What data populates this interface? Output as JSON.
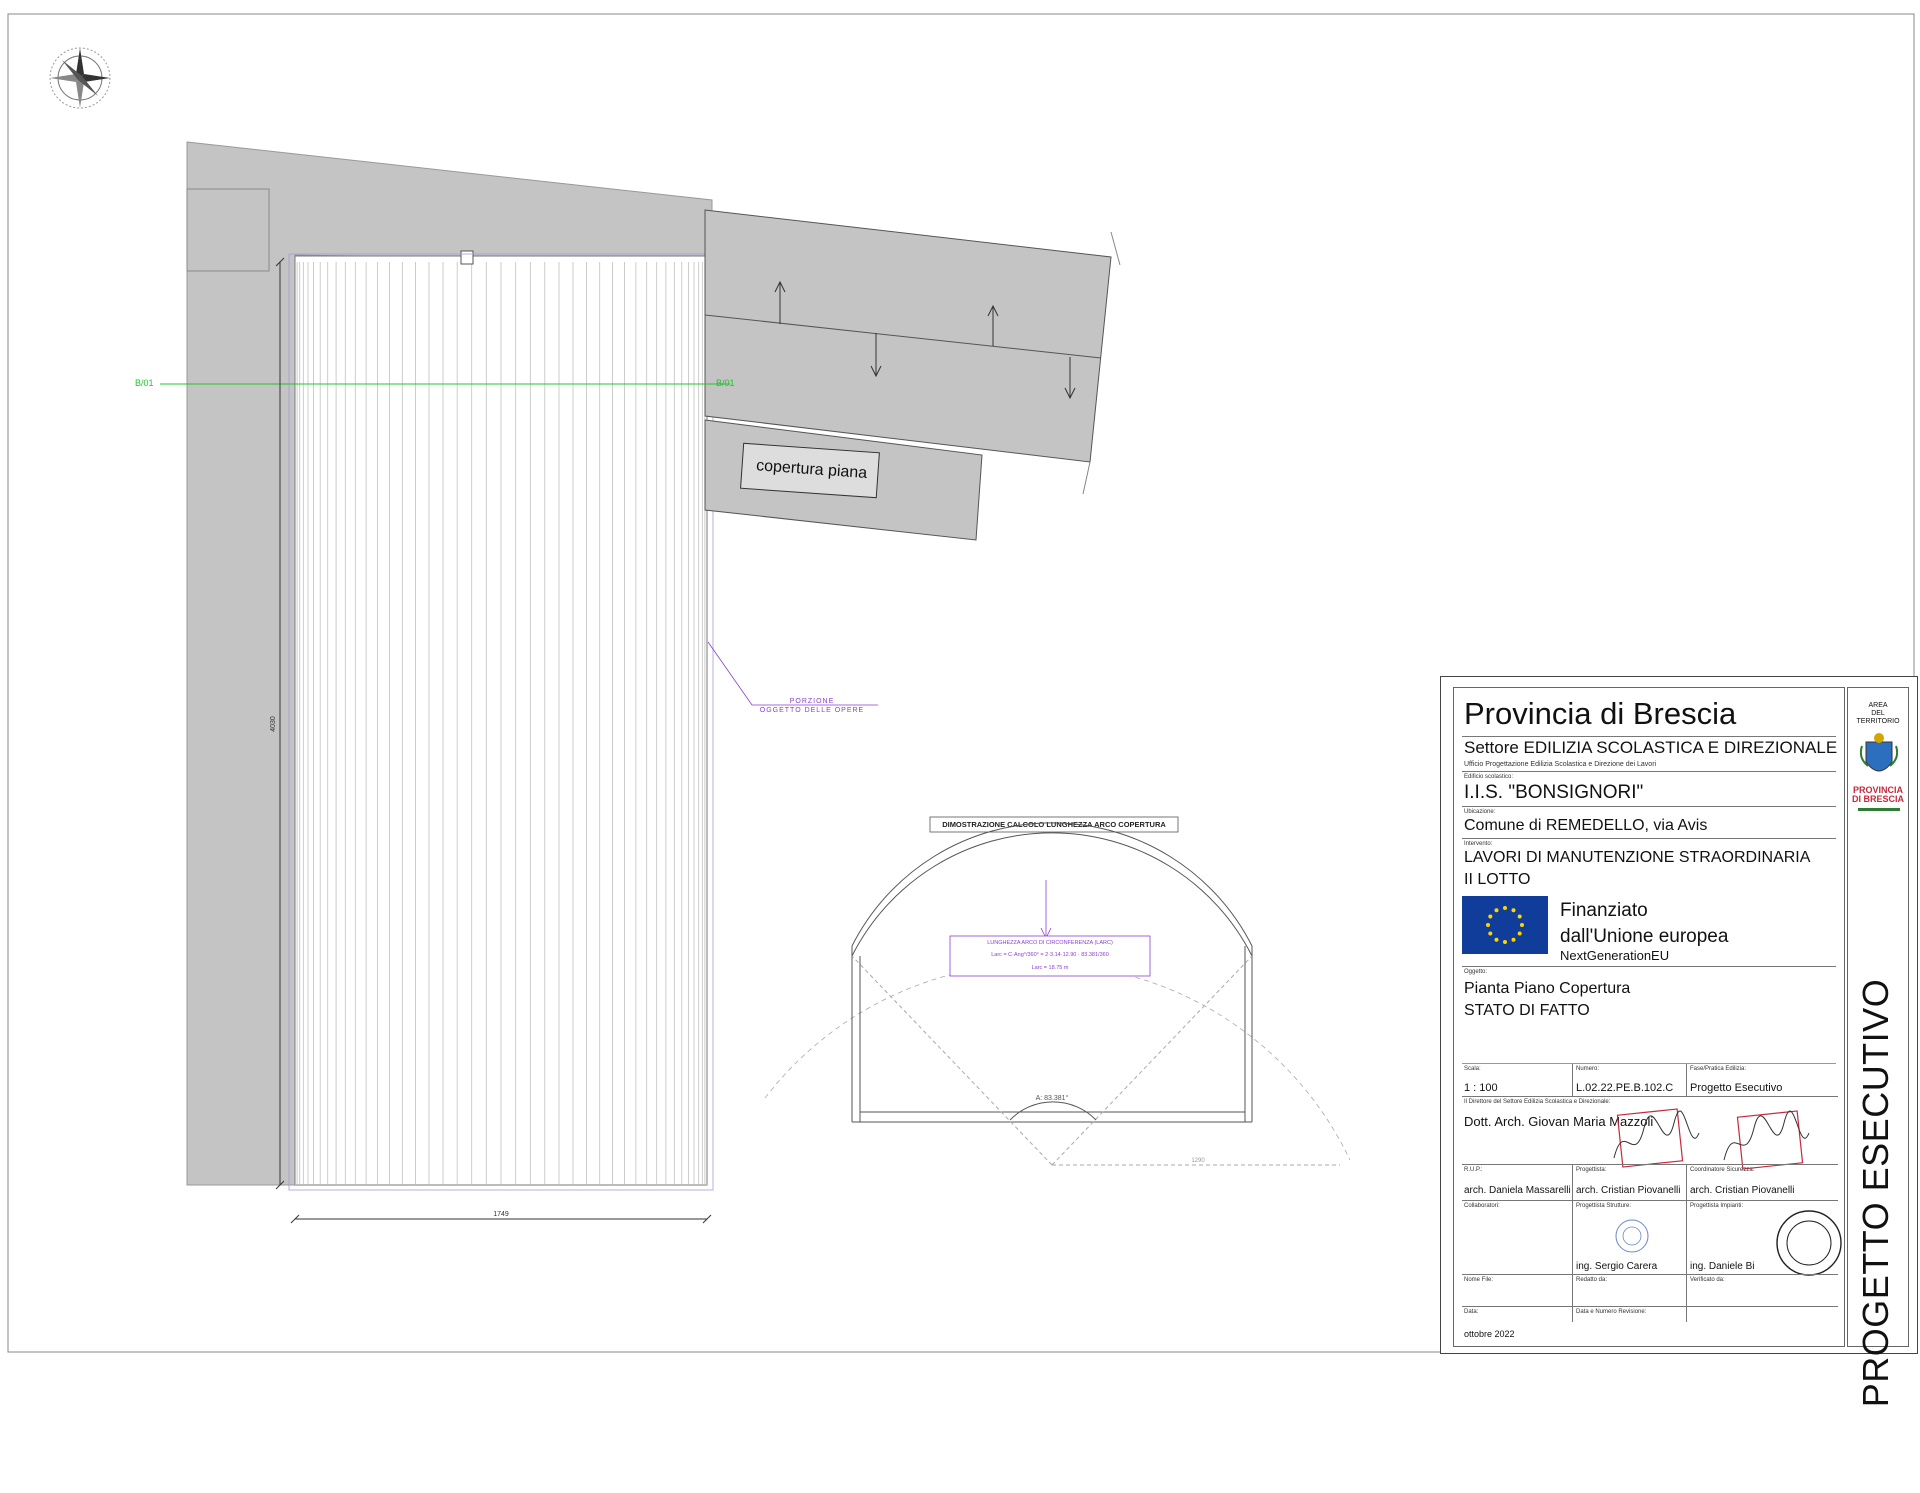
{
  "drawing": {
    "section_marks": [
      "B/01",
      "B/01"
    ],
    "roof_label": "copertura piana",
    "scope_note": [
      "PORZIONE",
      "OGGETTO DELLE OPERE"
    ],
    "dim_height": "4030",
    "dim_width": "1749",
    "arc_title": "DIMOSTRAZIONE CALCOLO LUNGHEZZA ARCO COPERTURA",
    "arc_formula": [
      "LUNGHEZZA ARCO DI CIRCONFERENZA (LARC)",
      "Larc = C·Ang°/360° = 2·3.14·12.90 · 83.381/360",
      "Larc = 18.75 m"
    ],
    "arc_angle": "A: 83.381°",
    "arc_radius_dim": "1290"
  },
  "title_block": {
    "authority": "Provincia di Brescia",
    "sector": "Settore EDILIZIA SCOLASTICA E DIREZIONALE",
    "office": "Ufficio Progettazione Edilizia Scolastica e Direzione dei Lavori",
    "building_label": "Edificio scolastico:",
    "building": "I.I.S. \"BONSIGNORI\"",
    "location_label": "Ubicazione:",
    "location": "Comune di REMEDELLO, via Avis",
    "works_label": "Intervento:",
    "works_line1": "LAVORI DI MANUTENZIONE STRAORDINARIA",
    "works_line2": "II  LOTTO",
    "funding_line1": "Finanziato",
    "funding_line2": "dall'Unione europea",
    "funding_line3": "NextGenerationEU",
    "object_label": "Oggetto:",
    "object_line1": "Pianta Piano Copertura",
    "object_line2": "STATO DI FATTO",
    "scale_label": "Scala:",
    "scale": "1 : 100",
    "number_label": "Numero:",
    "number": "L.02.22.PE.B.102.C",
    "phase_label": "Fase/Pratica Edilizia:",
    "phase": "Progetto  Esecutivo",
    "director_label": "Il Direttore del Settore Edilizia Scolastica e Direzionale:",
    "director": "Dott. Arch. Giovan Maria Mazzoli",
    "rup_label": "R.U.P.:",
    "rup": "arch. Daniela Massarelli",
    "designer_label": "Progettista:",
    "designer": "arch. Cristian Piovanelli",
    "coordinator_label": "Coordinatore Sicurezza:",
    "coordinator": "arch. Cristian Piovanelli",
    "collab_label": "Collaboratori:",
    "struct_label": "Progettista Strutture:",
    "struct": "ing. Sergio Carera",
    "plant_label": "Progettista Impianti:",
    "plant": "ing. Daniele Bi",
    "file_label": "Nome File:",
    "drafted_label": "Redatto da:",
    "checked_label": "Verificato da:",
    "date_label": "Data:",
    "date": "ottobre 2022",
    "revision_label": "Data e Numero Revisione:",
    "logo_text_1": "AREA",
    "logo_text_2": "DEL",
    "logo_text_3": "TERRITORIO",
    "logo_brand_1": "PROVINCIA",
    "logo_brand_2": "DI BRESCIA",
    "vertical_phase": "PROGETTO ESECUTIVO"
  },
  "colors": {
    "roof_grey": "#c4c4c4",
    "section_green": "#22c42a",
    "note_purple": "#8a3fd1",
    "eu_blue": "#0f3d99",
    "eu_star": "#ffd500",
    "stamp_red": "#c8283c"
  }
}
